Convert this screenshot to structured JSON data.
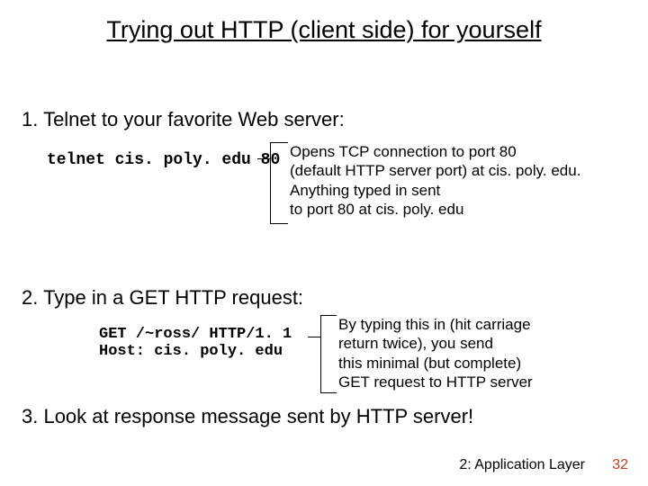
{
  "title": "Trying out HTTP (client side) for yourself",
  "steps": {
    "s1": "1. Telnet to your favorite Web server:",
    "s2": "2. Type in a GET HTTP request:",
    "s3": "3. Look at response message sent by HTTP server!"
  },
  "code": {
    "telnet": "telnet cis. poly. edu 80",
    "get": "GET /~ross/ HTTP/1. 1\nHost: cis. poly. edu"
  },
  "notes": {
    "n1": "Opens TCP connection to port 80\n(default HTTP server port) at cis. poly. edu.\nAnything typed in sent\nto port 80 at cis. poly. edu",
    "n2": "By typing this in (hit carriage\nreturn twice), you send\nthis minimal (but complete)\nGET request to HTTP server"
  },
  "footer": {
    "section": "2: Application Layer",
    "page": "32"
  }
}
